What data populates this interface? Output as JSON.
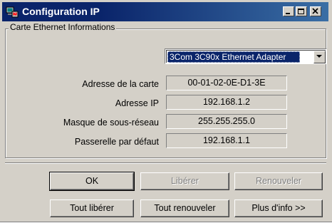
{
  "window": {
    "title": "Configuration IP",
    "icon": "network-computer-icon"
  },
  "group": {
    "legend": "Carte Ethernet  Informations"
  },
  "adapter_select": {
    "selected": "3Com 3C90x Ethernet Adapter"
  },
  "fields": [
    {
      "label": "Adresse de la carte",
      "value": "00-01-02-0E-D1-3E"
    },
    {
      "label": "Adresse IP",
      "value": "192.168.1.2"
    },
    {
      "label": "Masque de sous-réseau",
      "value": "255.255.255.0"
    },
    {
      "label": "Passerelle par défaut",
      "value": "192.168.1.1"
    }
  ],
  "buttons": {
    "ok": "OK",
    "release": "Libérer",
    "renew": "Renouveler",
    "release_all": "Tout libérer",
    "renew_all": "Tout renouveler",
    "more_info": "Plus d'info >>"
  },
  "colors": {
    "title_bar": "#0a246a",
    "dialog_face": "#d4d0c8",
    "selection": "#0a246a"
  }
}
